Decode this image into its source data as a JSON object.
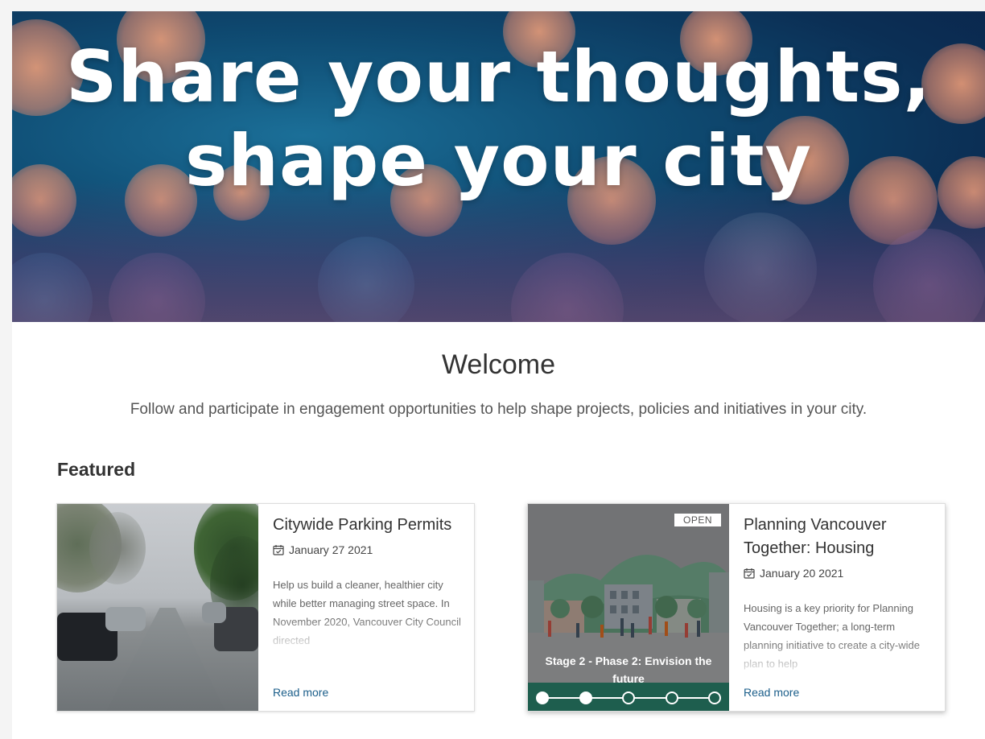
{
  "hero": {
    "title_line1": "Share your thoughts,",
    "title_line2": "shape your city"
  },
  "welcome": {
    "heading": "Welcome",
    "intro": "Follow and participate in engagement opportunities to help shape projects, policies and initiatives in your city."
  },
  "featured": {
    "heading": "Featured",
    "cards": [
      {
        "title": "Citywide Parking Permits",
        "date": "January 27 2021",
        "description": "Help us build a cleaner, healthier city while better managing street space. In November 2020, Vancouver City Council directed",
        "read_more": "Read more"
      },
      {
        "title": "Planning Vancouver Together: Housing",
        "date": "January 20 2021",
        "description": "Housing is a key priority for Planning Vancouver Together; a long-term planning initiative to create a city-wide plan to help",
        "read_more": "Read more",
        "badge": "OPEN",
        "stage": "Stage 2 - Phase 2: Envision the future",
        "stepper": {
          "total": 5,
          "completed": 2
        }
      }
    ]
  },
  "colors": {
    "link": "#1b5e8a",
    "stepper_bg": "#1e5e4e"
  }
}
